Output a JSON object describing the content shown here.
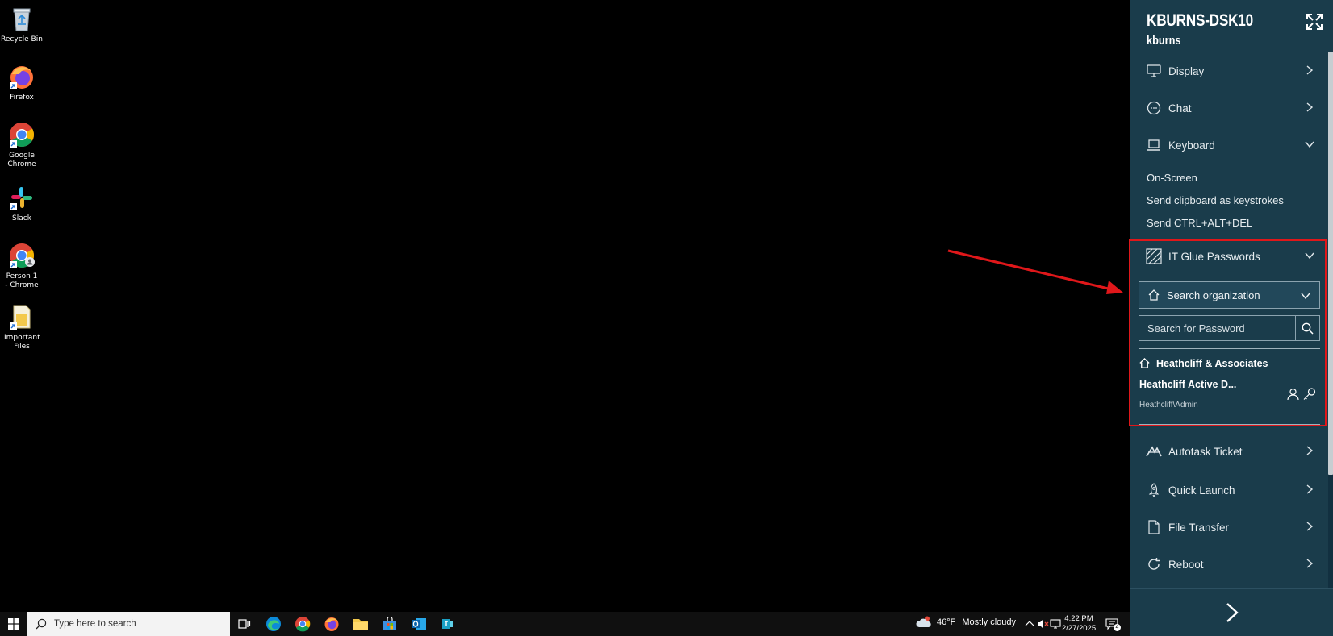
{
  "desktop": {
    "icons": [
      {
        "label": "Recycle Bin",
        "icon": "recycle-bin-icon"
      },
      {
        "label": "Firefox",
        "icon": "firefox-icon"
      },
      {
        "label": "Google Chrome",
        "icon": "chrome-icon"
      },
      {
        "label": "Slack",
        "icon": "slack-icon"
      },
      {
        "label": "Person 1 - Chrome",
        "icon": "chrome-profile-icon"
      },
      {
        "label": "Important Files",
        "icon": "folder-icon"
      }
    ]
  },
  "panel": {
    "hostname": "KBURNS-DSK10",
    "username": "kburns",
    "menu": {
      "display": "Display",
      "chat": "Chat",
      "keyboard": "Keyboard",
      "keyboard_items": [
        "On-Screen",
        "Send clipboard as keystrokes",
        "Send CTRL+ALT+DEL"
      ],
      "itglue": "IT Glue Passwords",
      "autotask": "Autotask Ticket",
      "quick_launch": "Quick Launch",
      "file_transfer": "File Transfer",
      "reboot": "Reboot"
    },
    "itglue": {
      "org_select": "Search organization",
      "password_placeholder": "Search for Password",
      "org_result": "Heathcliff & Associates",
      "entry_title": "Heathcliff Active D...",
      "entry_username": "Heathcliff\\Admin"
    },
    "accent_color": "#1a3c4b",
    "highlight_color": "#e0171a"
  },
  "taskbar": {
    "search_placeholder": "Type here to search",
    "apps": [
      "task-view-icon",
      "edge-icon",
      "chrome-icon",
      "firefox-icon",
      "file-explorer-icon",
      "store-icon",
      "outlook-icon",
      "teams-like-icon"
    ],
    "weather_temp": "46°F",
    "weather_desc": "Mostly cloudy",
    "time": "4:22 PM",
    "date": "2/27/2025",
    "notification_count": "4"
  }
}
